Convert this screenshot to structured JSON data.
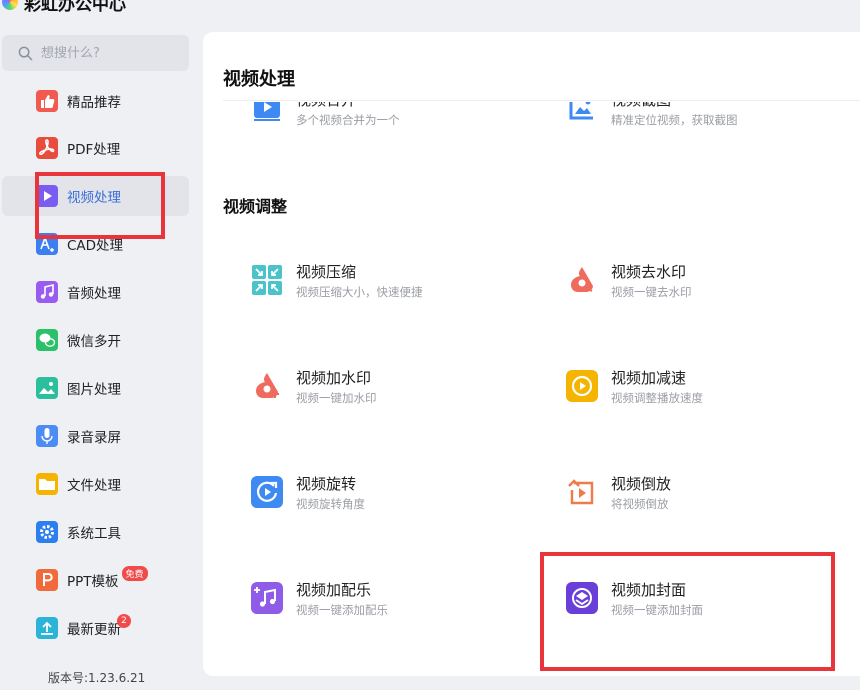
{
  "app": {
    "title": "彩虹办公中心"
  },
  "search": {
    "placeholder": "想搜什么?"
  },
  "sidebar": {
    "items": [
      {
        "label": "精品推荐",
        "icon": "thumbs-up-icon",
        "color": "#f25a4f",
        "active": false
      },
      {
        "label": "PDF处理",
        "icon": "pdf-icon",
        "color": "#e84c3d",
        "active": false
      },
      {
        "label": "视频处理",
        "icon": "video-play-icon",
        "color": "#7b5cf0",
        "active": true
      },
      {
        "label": "CAD处理",
        "icon": "cad-icon",
        "color": "#3d7ef0",
        "active": false
      },
      {
        "label": "音频处理",
        "icon": "music-icon",
        "color": "#9a5cf0",
        "active": false
      },
      {
        "label": "微信多开",
        "icon": "wechat-icon",
        "color": "#2bc06a",
        "active": false
      },
      {
        "label": "图片处理",
        "icon": "image-icon",
        "color": "#2bbf9e",
        "active": false
      },
      {
        "label": "录音录屏",
        "icon": "microphone-icon",
        "color": "#4b8cf5",
        "active": false
      },
      {
        "label": "文件处理",
        "icon": "folder-icon",
        "color": "#f5b400",
        "active": false
      },
      {
        "label": "系统工具",
        "icon": "gear-icon",
        "color": "#2d7ff0",
        "active": false
      },
      {
        "label": "PPT模板",
        "icon": "ppt-icon",
        "color": "#f06a3c",
        "active": false,
        "badge": "免费"
      },
      {
        "label": "最新更新",
        "icon": "upload-icon",
        "color": "#2bb4d8",
        "active": false,
        "badge": "2"
      }
    ],
    "version": "版本号:1.23.6.21"
  },
  "main": {
    "title": "视频处理",
    "partial_cards": [
      {
        "name": "视频合并",
        "desc": "多个视频合并为一个",
        "icon": "video-merge-icon"
      },
      {
        "name": "视频截图",
        "desc": "精准定位视频，获取截图",
        "icon": "video-screenshot-icon"
      }
    ],
    "section": {
      "title": "视频调整",
      "cards": [
        {
          "name": "视频压缩",
          "desc": "视频压缩大小，快速便捷",
          "icon": "compress-icon"
        },
        {
          "name": "视频去水印",
          "desc": "视频一键去水印",
          "icon": "remove-watermark-icon"
        },
        {
          "name": "视频加水印",
          "desc": "视频一键加水印",
          "icon": "add-watermark-icon"
        },
        {
          "name": "视频加减速",
          "desc": "视频调整播放速度",
          "icon": "speed-icon"
        },
        {
          "name": "视频旋转",
          "desc": "视频旋转角度",
          "icon": "rotate-icon"
        },
        {
          "name": "视频倒放",
          "desc": "将视频倒放",
          "icon": "reverse-icon"
        },
        {
          "name": "视频加配乐",
          "desc": "视频一键添加配乐",
          "icon": "add-music-icon"
        },
        {
          "name": "视频加封面",
          "desc": "视频一键添加封面",
          "icon": "add-cover-icon"
        }
      ]
    }
  },
  "colors": {
    "highlight": "#e8353b",
    "active_text": "#3a6fd8"
  }
}
